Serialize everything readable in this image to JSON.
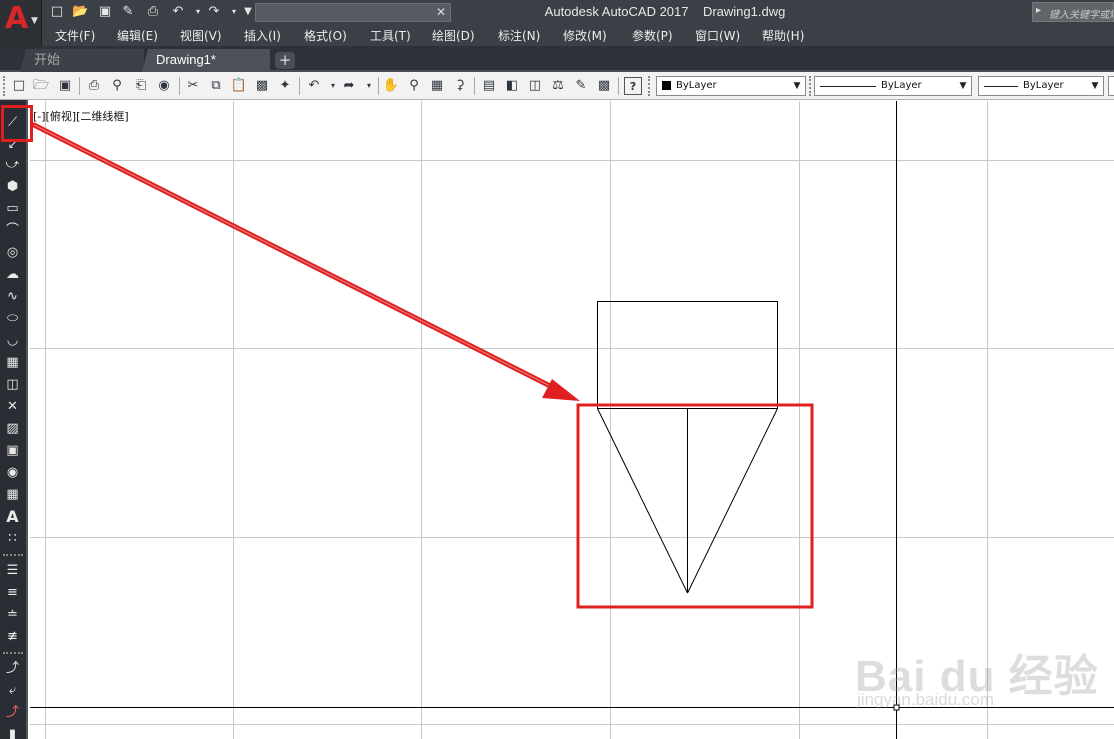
{
  "title_bar": {
    "app_logo": "A",
    "title": "Autodesk AutoCAD 2017    Drawing1.dwg",
    "keyword_search_placeholder": "键入关键字或短语"
  },
  "menu": [
    "文件(F)",
    "编辑(E)",
    "视图(V)",
    "插入(I)",
    "格式(O)",
    "工具(T)",
    "绘图(D)",
    "标注(N)",
    "修改(M)",
    "参数(P)",
    "窗口(W)",
    "帮助(H)"
  ],
  "tabs": {
    "start": "开始",
    "drawing": "Drawing1*",
    "add": "+"
  },
  "properties": {
    "color": "ByLayer",
    "linetype": "ByLayer",
    "lineweight": "ByLayer"
  },
  "viewport_label": "[-][俯视][二维线框]",
  "watermark": {
    "brand": "Bai du 经验",
    "url": "jingyan.baidu.com"
  },
  "colors": {
    "title_bar": "#3b3f46",
    "logo_red": "#d8262a",
    "highlight_red": "#e02020",
    "canvas": "#ffffff",
    "grid": "#c8c8c8",
    "axis": "#000000"
  },
  "icons": {
    "quick_access": [
      "new-icon",
      "open-icon",
      "save-icon",
      "save-as-icon",
      "print-icon",
      "undo-icon",
      "redo-icon",
      "customize-icon"
    ],
    "left_toolbar": [
      "line-icon",
      "construction-line-icon",
      "polyline-icon",
      "polygon-icon",
      "rectangle-icon",
      "arc-icon",
      "circle-icon",
      "revision-cloud-icon",
      "spline-icon",
      "ellipse-icon",
      "ellipse-arc-icon",
      "insert-block-icon",
      "make-block-icon",
      "point-icon",
      "hatch-icon",
      "gradient-icon",
      "region-icon",
      "table-icon",
      "multiline-text-icon",
      "add-selected-icon"
    ]
  }
}
